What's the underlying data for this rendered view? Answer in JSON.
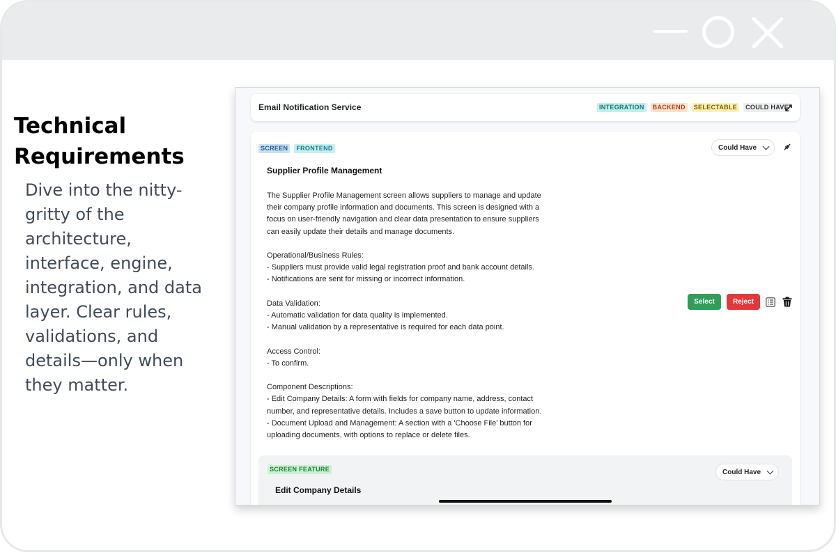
{
  "window": {
    "controls": [
      "minimize-icon",
      "maximize-icon",
      "close-icon"
    ]
  },
  "left": {
    "heading": "Technical Requirements",
    "description": "Dive into the nitty-gritty of the architecture, interface, engine, integration, and data layer. Clear rules, validations, and details—only when they matter."
  },
  "top_card": {
    "title": "Email Notification Service",
    "tags": [
      "INTEGRATION",
      "BACKEND",
      "SELECTABLE",
      "COULD HAVE"
    ],
    "expand_icon": "expand-icon"
  },
  "main_card": {
    "tags": [
      "SCREEN",
      "FRONTEND"
    ],
    "priority": "Could Have",
    "collapse_icon": "collapse-icon",
    "title": "Supplier Profile Management",
    "body": "The Supplier Profile Management screen allows suppliers to manage and update\ntheir company profile information and documents. This screen is designed with a\nfocus on user-friendly navigation and clear data presentation to ensure suppliers\ncan easily update their details and manage documents.\n\nOperational/Business Rules:\n- Suppliers must provide valid legal registration proof and bank account details.\n- Notifications are sent for missing or incorrect information.\n\nData Validation:\n- Automatic validation for data quality is implemented.\n- Manual validation by a representative is required for each data point.\n\nAccess Control:\n- To confirm.\n\nComponent Descriptions:\n- Edit Company Details: A form with fields for company name, address, contact\nnumber, and representative details. Includes a save button to update information.\n- Document Upload and Management: A section with a 'Choose File' button for\nuploading documents, with options to replace or delete files.",
    "select_label": "Select",
    "reject_label": "Reject",
    "colors": {
      "select": "#2e9e5a",
      "reject": "#e2383b"
    }
  },
  "feature": {
    "tag": "SCREEN FEATURE",
    "priority": "Could Have",
    "title": "Edit Company Details"
  }
}
